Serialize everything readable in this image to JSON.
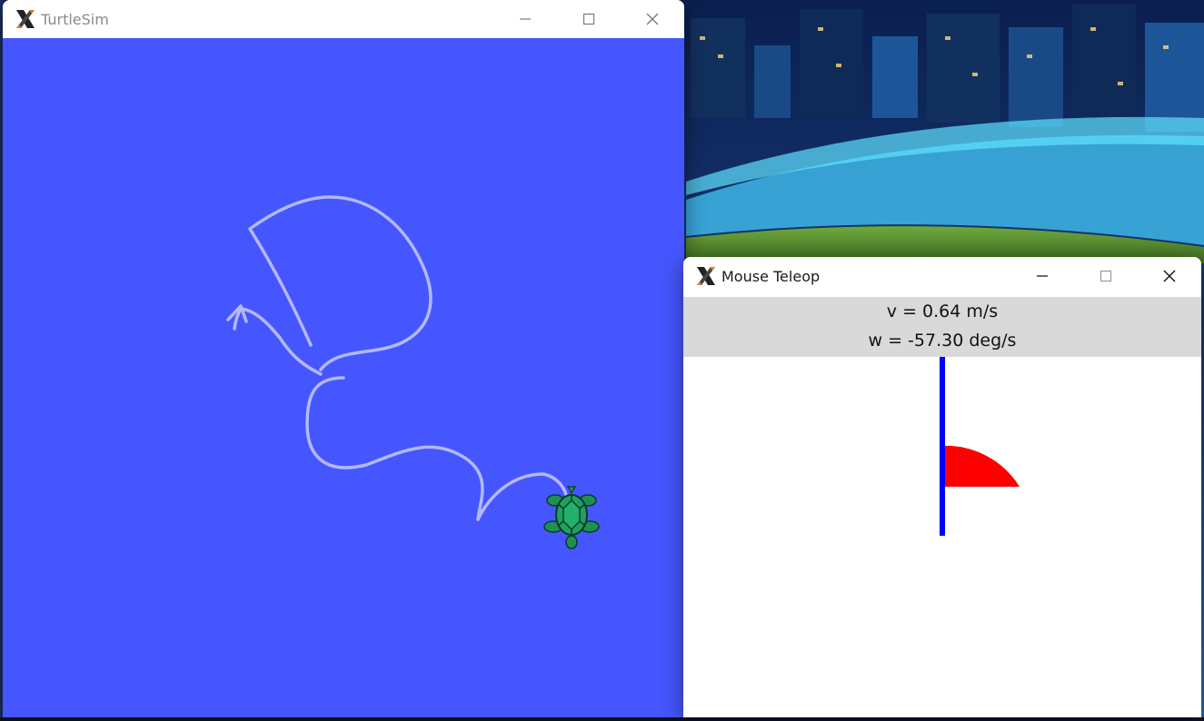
{
  "desktop": {
    "wallpaper": "night-stadium-cityscape"
  },
  "turtlesim": {
    "title": "TurtleSim",
    "icon": "x-app-icon",
    "background_color": "#4556ff",
    "trail_color": "#b3b8ff",
    "turtle_icon": "turtle-icon",
    "controls": [
      "minimize-icon",
      "maximize-icon",
      "close-icon"
    ]
  },
  "teleop": {
    "title": "Mouse Teleop",
    "icon": "x-app-icon",
    "linear_velocity_text": "v = 0.64 m/s",
    "angular_velocity_text": "w = -57.30 deg/s",
    "readout_background": "#d9d9d9",
    "linear_indicator_color": "#0000ff",
    "angular_indicator_color": "#ff0000",
    "controls": [
      "minimize-icon",
      "maximize-icon",
      "close-icon"
    ]
  }
}
